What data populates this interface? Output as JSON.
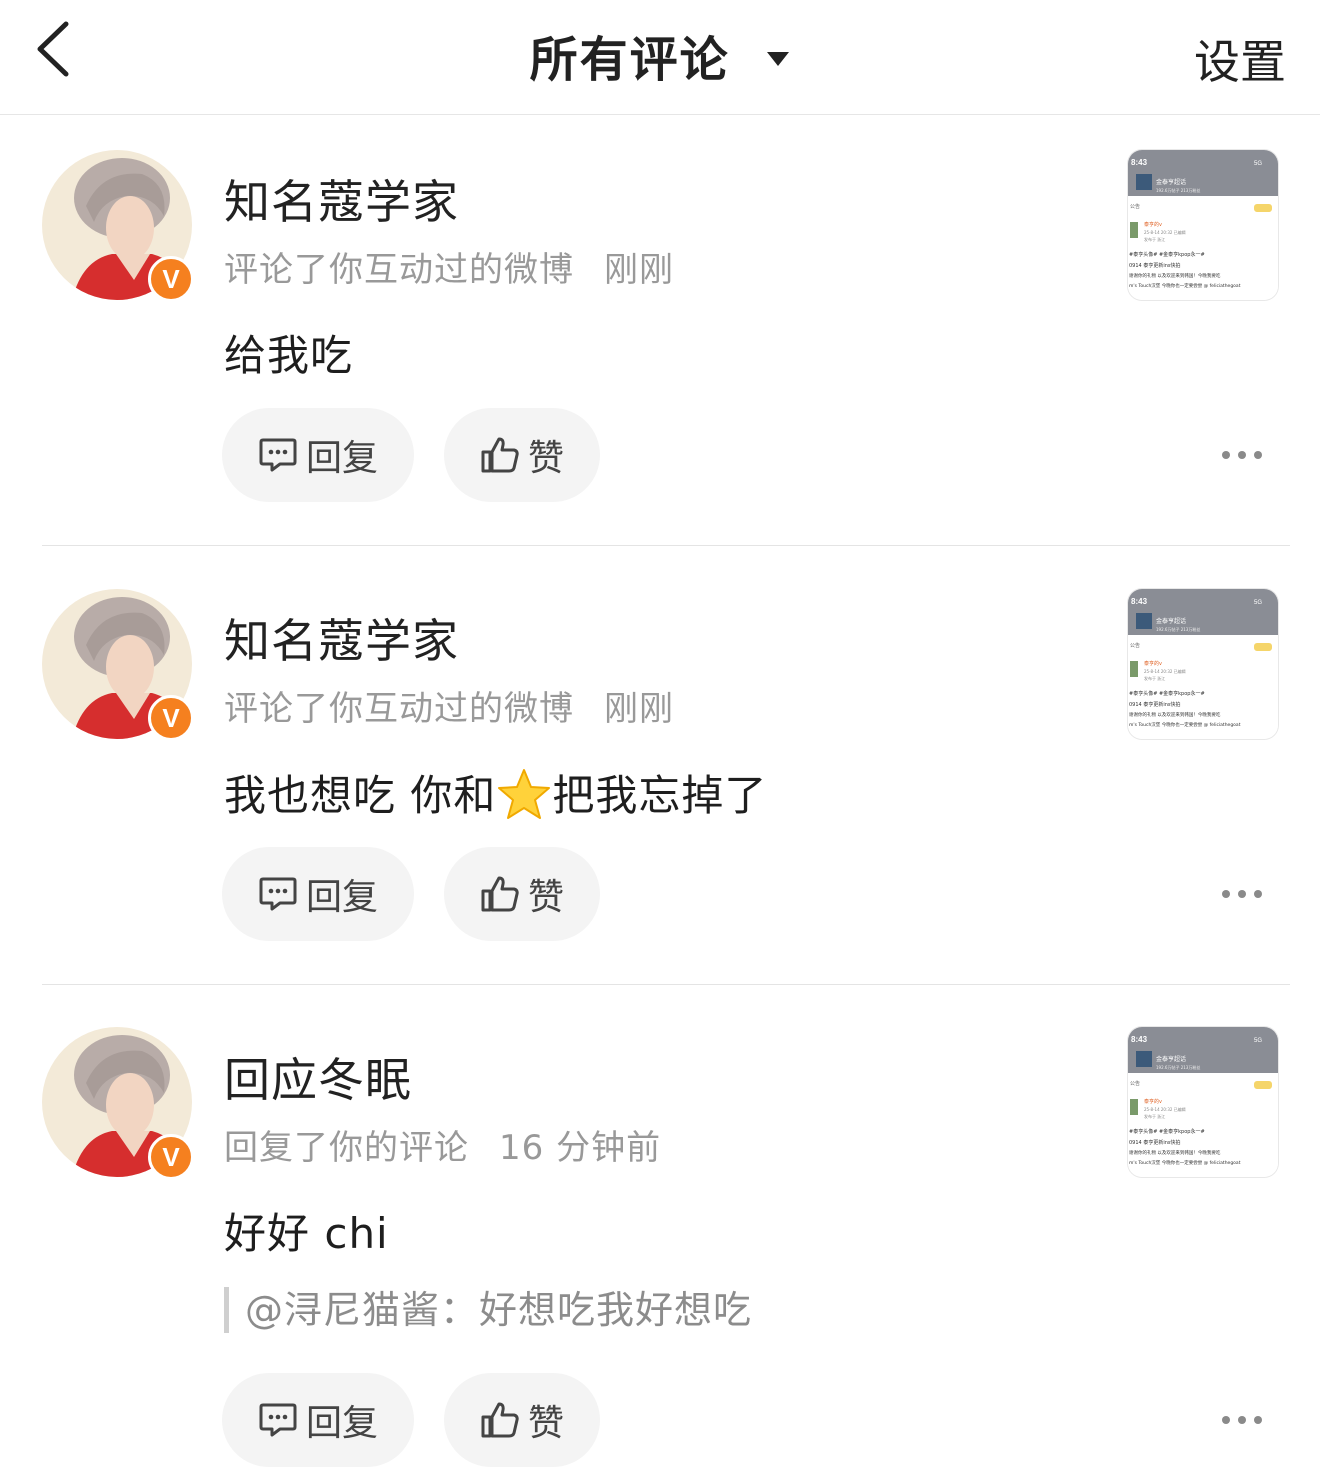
{
  "header": {
    "title": "所有评论",
    "settings_label": "设置"
  },
  "comments": [
    {
      "name": "知名蔻学家",
      "action": "评论了你互动过的微博",
      "time": "刚刚",
      "content": "给我吃",
      "reply_label": "回复",
      "like_label": "赞",
      "verified": true
    },
    {
      "name": "知名蔻学家",
      "action": "评论了你互动过的微博",
      "time": "刚刚",
      "content_before": "我也想吃 你和",
      "emoji": "star-emoji",
      "content_after": "把我忘掉了",
      "reply_label": "回复",
      "like_label": "赞",
      "verified": true
    },
    {
      "name": "回应冬眠",
      "action": "回复了你的评论",
      "time": "16 分钟前",
      "content": "好好 chi",
      "quote": "@浔尼猫酱：好想吃我好想吃",
      "reply_label": "回复",
      "like_label": "赞",
      "verified": true
    }
  ],
  "thumbnail": {
    "status_time": "8:43",
    "network": "5G",
    "account_name": "金泰亨超话",
    "account_stats": "192.6万帖子 213万粉丝",
    "tab": "公告",
    "poster": "泰亨的v",
    "post_time": "25-8-14 20:32 已编辑",
    "post_location": "发布于 浙江",
    "hashtags": "#泰亨头像# #金泰亨kpop永一#",
    "line1": "0914 泰亨更新ins快拍",
    "line2": "谢谢你的礼物 以及欢迎来到韩国！今晚我要吃",
    "line3": "m's Touch汉堡 今晚你也一定要尝尝 @ feliciathegoat"
  },
  "colors": {
    "badge": "#f5801f",
    "meta_gray": "#999999",
    "button_bg": "#f4f4f4"
  }
}
